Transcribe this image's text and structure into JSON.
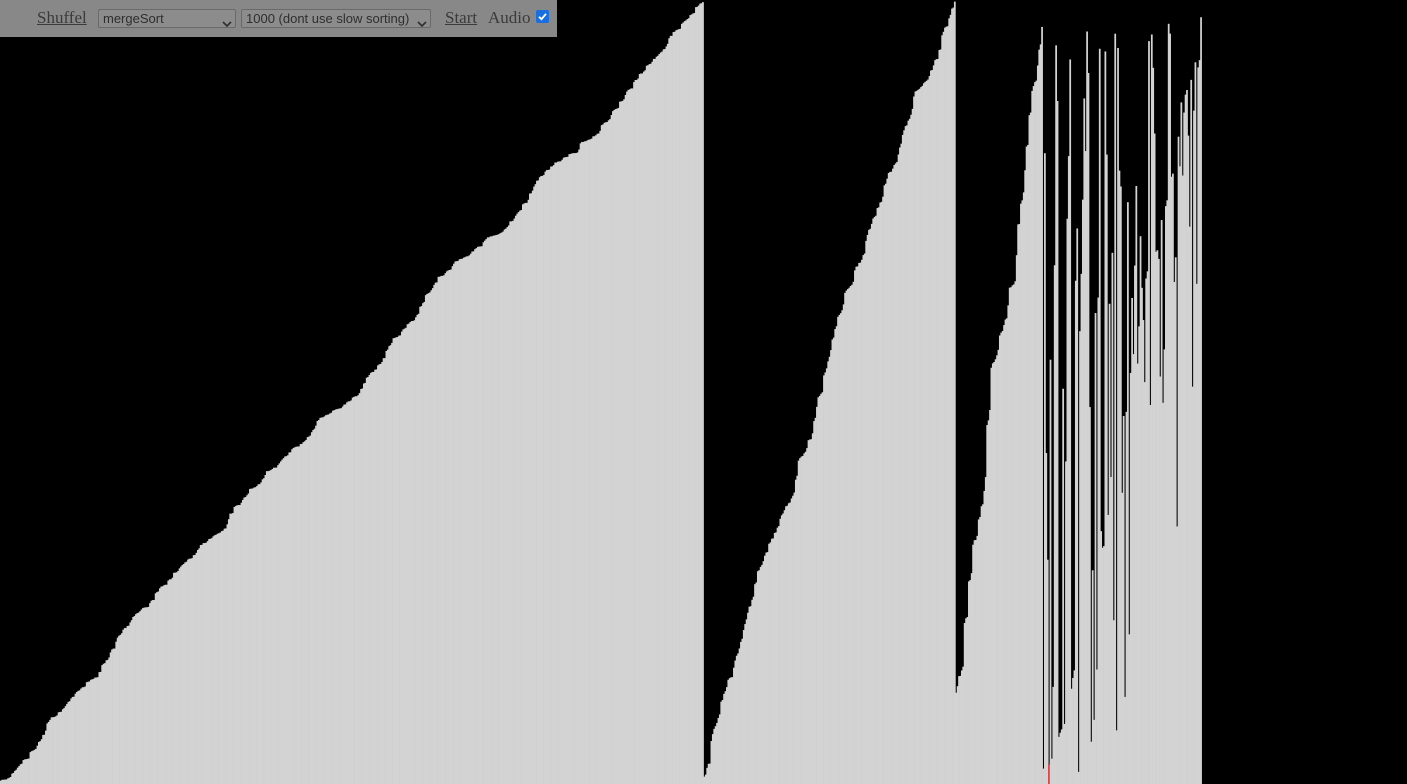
{
  "controls": {
    "shuffle_label": "Shuffel",
    "algorithm": {
      "selected": "mergeSort"
    },
    "size": {
      "selected": "1000 (dont use slow sorting)"
    },
    "start_label": "Start",
    "audio_label": "Audio",
    "audio_enabled": true
  },
  "visualizer": {
    "bar_count": 1000,
    "background_color": "#000000",
    "bar_color": "#d3d3d3",
    "highlight_color": "#e02020",
    "sorted_runs": [
      {
        "from": 0,
        "to": 499
      },
      {
        "from": 500,
        "to": 678
      },
      {
        "from": 679,
        "to": 740
      }
    ],
    "merge_region": {
      "from": 741,
      "to": 853
    },
    "unsorted_region": {
      "from": 854,
      "to": 999
    },
    "active_index": 745
  },
  "colors": {
    "toolbar_bg": "#888888",
    "toolbar_text": "#3a3a3a",
    "checkbox_accent": "#1a6fe0"
  }
}
